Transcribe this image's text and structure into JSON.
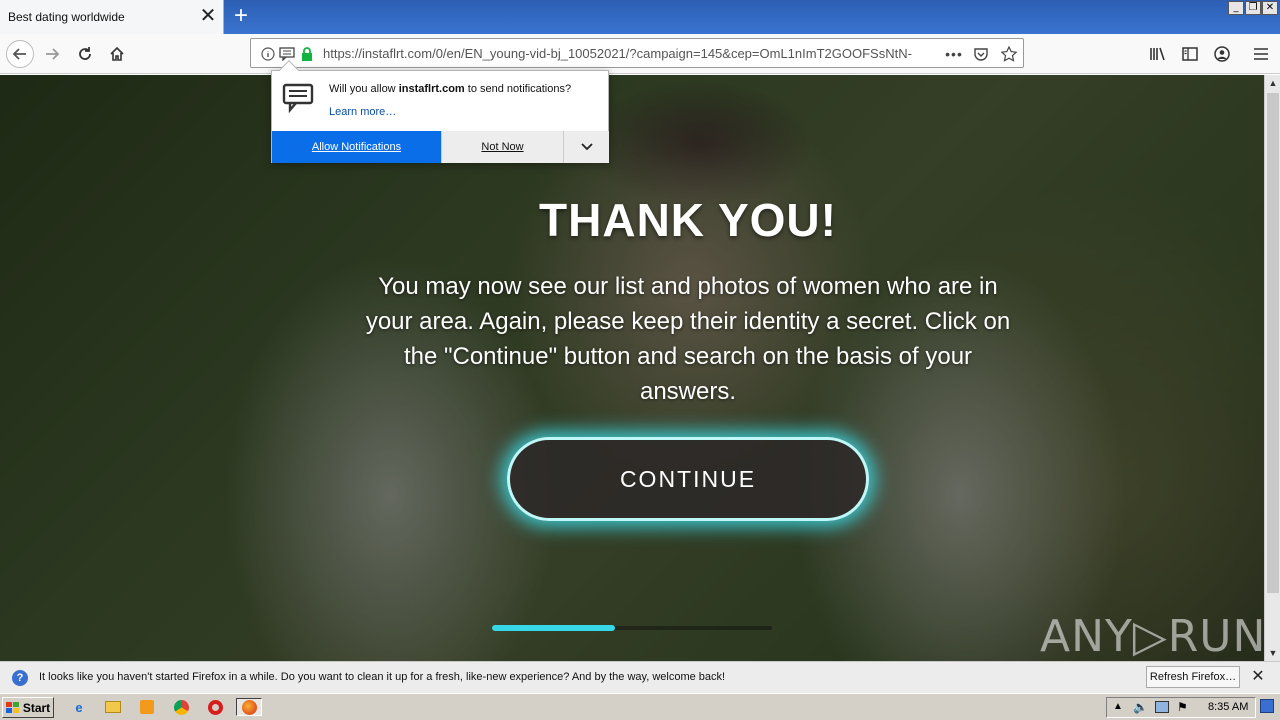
{
  "browser": {
    "tab_title": "Best dating worldwide",
    "tab_close": "✕",
    "new_tab": "+",
    "url": "https://instaflrt.com/0/en/EN_young-vid-bj_10052021/?campaign=145&cep=OmL1nImT2GOOFSsNtN-",
    "window_buttons": [
      "_",
      "❐",
      "✕"
    ]
  },
  "notification_popup": {
    "prompt_prefix": "Will you allow ",
    "site": "instaflrt.com",
    "prompt_suffix": " to send notifications?",
    "learn_more": "Learn more…",
    "allow": "Allow Notifications",
    "not_now": "Not Now"
  },
  "page": {
    "heading": "THANK YOU!",
    "message": "You may now see our list and photos of women who are in your area. Again, please keep their identity a secret. Click on the \"Continue\" button and search on the basis of your answers.",
    "continue": "CONTINUE",
    "progress": 0.44,
    "watermark": "ANY▷RUN",
    "accent_color": "#36d7e6"
  },
  "notification_bar": {
    "icon": "?",
    "text": "It looks like you haven't started Firefox in a while. Do you want to clean it up for a fresh, like-new experience? And by the way, welcome back!",
    "refresh": "Refresh Firefox…",
    "close": "✕"
  },
  "taskbar": {
    "start": "Start",
    "clock": "8:35 AM",
    "apps": [
      "ie-icon",
      "explorer-icon",
      "media-player-icon",
      "chrome-icon",
      "opera-icon",
      "firefox-icon"
    ]
  }
}
